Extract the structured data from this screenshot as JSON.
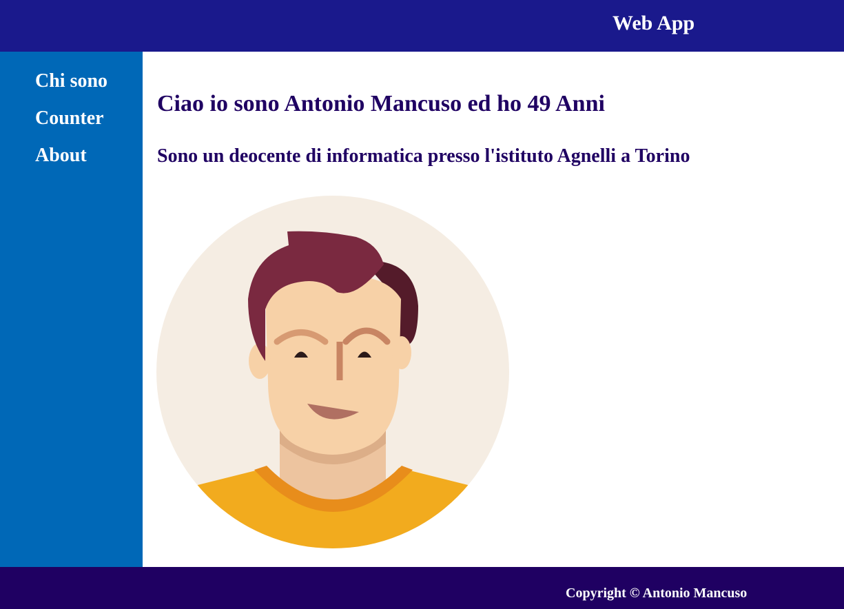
{
  "header": {
    "title": "Web App"
  },
  "sidebar": {
    "items": [
      {
        "label": "Chi sono"
      },
      {
        "label": "Counter"
      },
      {
        "label": "About"
      }
    ]
  },
  "main": {
    "heading": "Ciao io sono Antonio Mancuso ed ho 49 Anni",
    "subheading": "Sono un deocente di informatica presso l'istituto Agnelli a Torino",
    "avatar_icon": "avatar-illustration"
  },
  "footer": {
    "copyright": "Copyright © Antonio Mancuso"
  },
  "colors": {
    "header_bg": "#1a198c",
    "sidebar_bg": "#0068b7",
    "footer_bg": "#1f0062",
    "heading_text": "#1f0062"
  }
}
